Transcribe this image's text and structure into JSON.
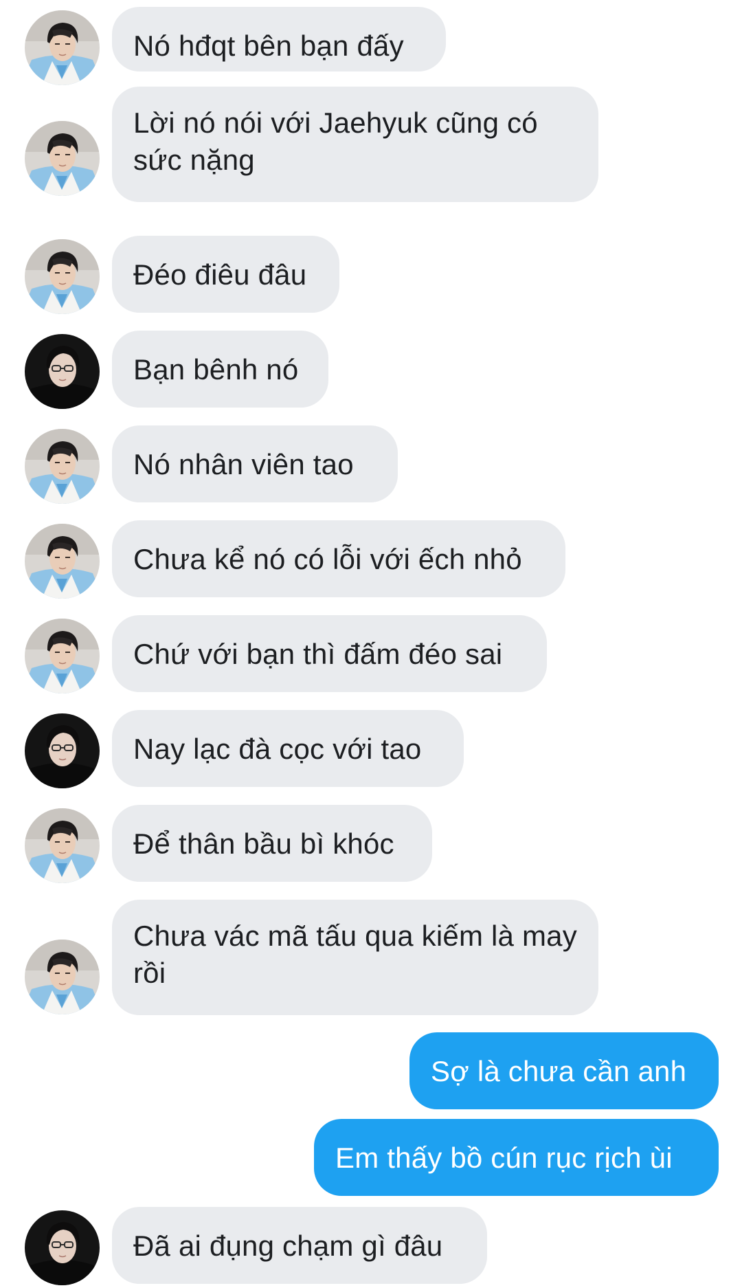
{
  "messages": [
    {
      "text": "Nó hđqt bên bạn đấy",
      "direction": "in",
      "avatar": "avatar-hanbok"
    },
    {
      "text": "Lời nó nói với Jaehyuk cũng có sức nặng",
      "direction": "in",
      "avatar": "avatar-hanbok"
    },
    {
      "text": "Đéo điêu đâu",
      "direction": "in",
      "avatar": "avatar-hanbok"
    },
    {
      "text": "Bạn bênh nó",
      "direction": "in",
      "avatar": "avatar-glasses"
    },
    {
      "text": "Nó nhân viên tao",
      "direction": "in",
      "avatar": "avatar-hanbok"
    },
    {
      "text": "Chưa kể nó có lỗi với ếch nhỏ",
      "direction": "in",
      "avatar": "avatar-hanbok"
    },
    {
      "text": "Chứ với bạn thì đấm đéo sai",
      "direction": "in",
      "avatar": "avatar-hanbok"
    },
    {
      "text": "Nay lạc đà cọc với tao",
      "direction": "in",
      "avatar": "avatar-glasses"
    },
    {
      "text": "Để thân bầu bì khóc",
      "direction": "in",
      "avatar": "avatar-hanbok"
    },
    {
      "text": "Chưa vác mã tấu qua kiếm là may rồi",
      "direction": "in",
      "avatar": "avatar-hanbok"
    },
    {
      "text": "Sợ là chưa cần anh",
      "direction": "out"
    },
    {
      "text": "Em thấy bồ cún rục rịch ùi",
      "direction": "out"
    },
    {
      "text": "Đã ai đụng chạm gì đâu",
      "direction": "in",
      "avatar": "avatar-glasses"
    }
  ],
  "colors": {
    "incoming_bubble": "#e9ebee",
    "outgoing_bubble": "#1ea1f1",
    "incoming_text": "#1c1e21",
    "outgoing_text": "#ffffff"
  }
}
